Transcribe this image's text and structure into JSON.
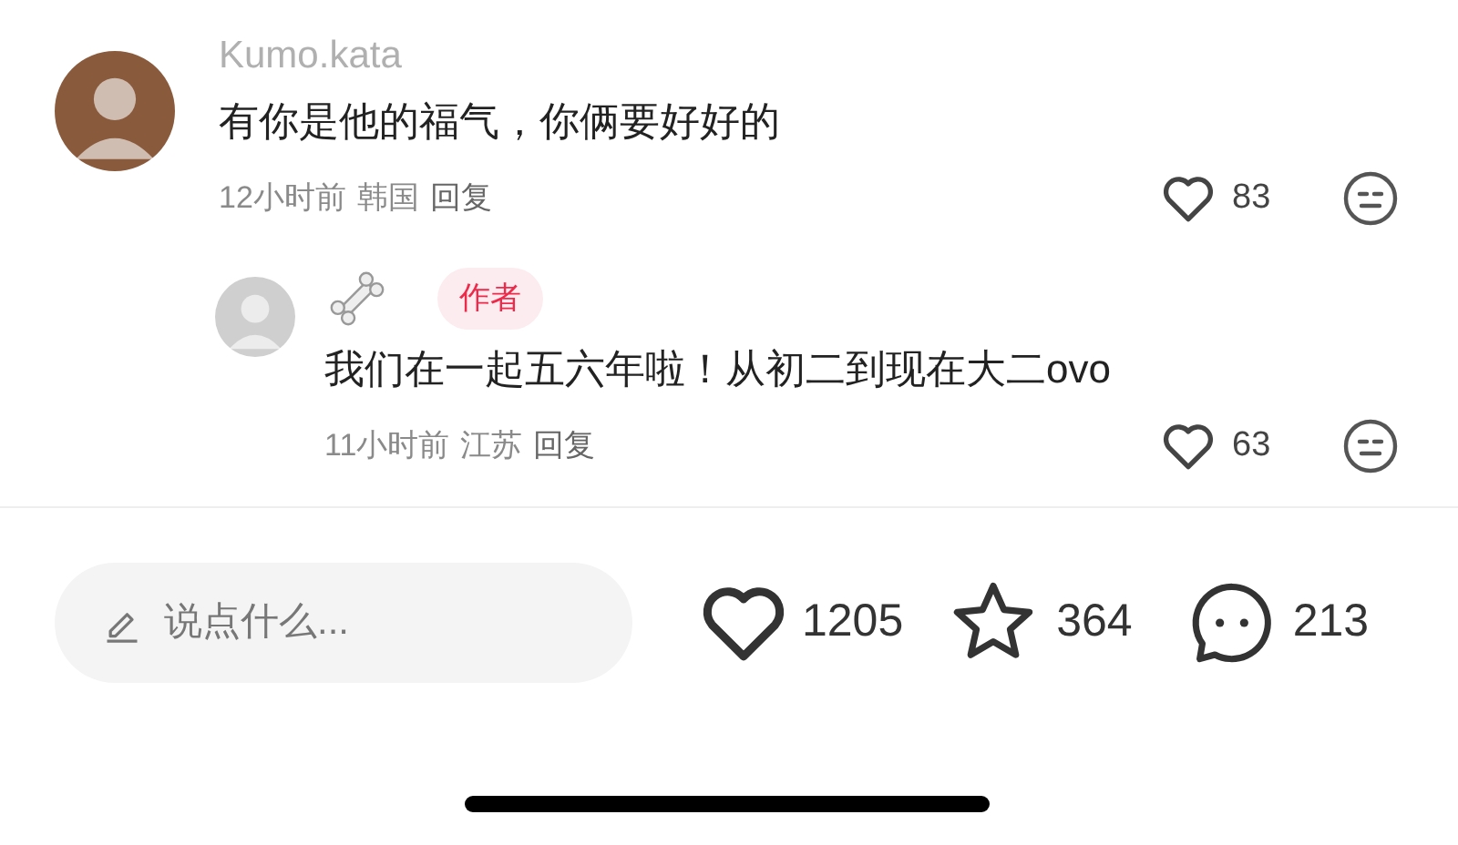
{
  "comments": [
    {
      "author": "Kumo.kata",
      "text": "有你是他的福气，你俩要好好的",
      "time": "12小时前",
      "location": "韩国",
      "reply": "回复",
      "likes": "83",
      "replies": [
        {
          "author_badge": "作者",
          "text": "我们在一起五六年啦！从初二到现在大二ovo",
          "time": "11小时前",
          "location": "江苏",
          "reply": "回复",
          "likes": "63"
        }
      ]
    }
  ],
  "bottom_bar": {
    "input": {
      "placeholder": "说点什么..."
    },
    "likes": "1205",
    "favorites": "364",
    "comments": "213"
  }
}
